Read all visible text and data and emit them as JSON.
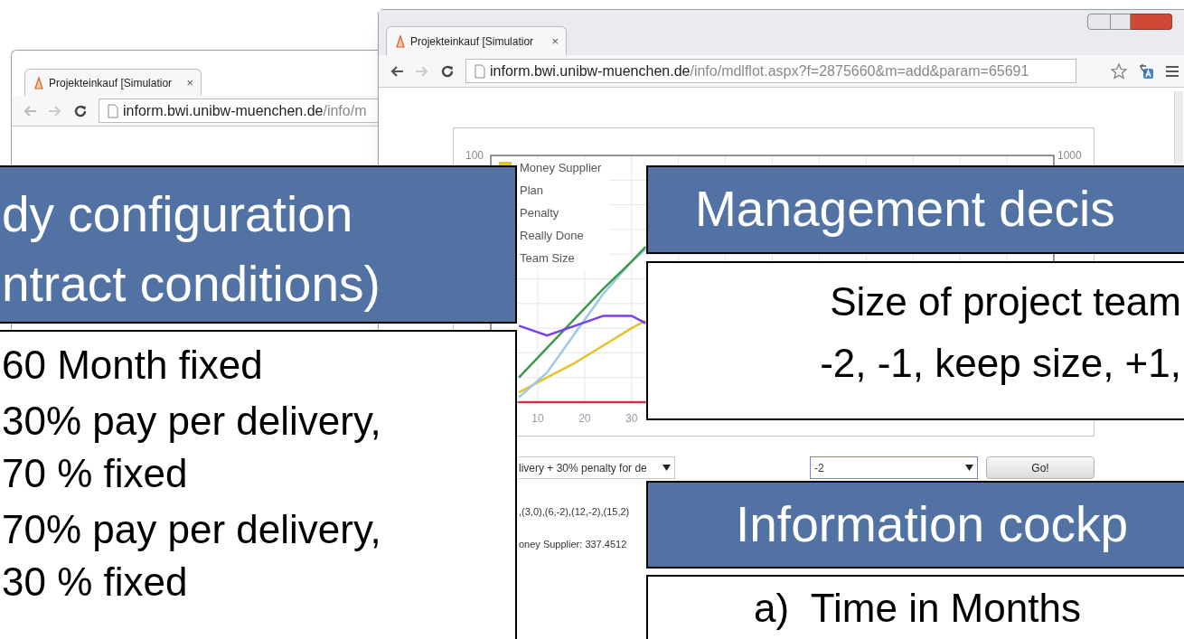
{
  "back_window": {
    "tab_title": "Projekteinkauf [Simulatior",
    "tab_close": "×",
    "url_host": "inform.bwi.unibw-muenchen.de",
    "url_path": "/info/m"
  },
  "front_window": {
    "tab_title": "Projekteinkauf [Simulatior",
    "tab_close": "×",
    "url_host": "inform.bwi.unibw-muenchen.de",
    "url_path": "/info/mdlflot.aspx?f=2875660&m=add&param=65691",
    "chart": {
      "legend": [
        "Money Supplier",
        "Plan",
        "Penalty",
        "Really Done",
        "Team Size"
      ],
      "left_axis_label": "100",
      "right_axis_label": "1000",
      "x_axis_labels": [
        "10",
        "20",
        "30"
      ]
    },
    "plan_select": {
      "value": "livery + 30% penalty for de"
    },
    "team_select": {
      "value": "-2"
    },
    "go_button": "Go!",
    "output_lines": [
      ",(3,0),(6,-2),(12,-2),(15,2)",
      "oney Supplier: 337.4512"
    ]
  },
  "callouts": [
    {
      "kind": "title",
      "lines": [
        "dy configuration",
        "ntract conditions)"
      ]
    },
    {
      "kind": "list",
      "items": [
        "60 Month fixed",
        "30% pay per delivery,\n70 % fixed",
        "70% pay per delivery,\n30 % fixed"
      ]
    },
    {
      "kind": "title",
      "lines": [
        "Management decis"
      ]
    },
    {
      "kind": "list",
      "items": [
        "Size of project team",
        "-2, -1, keep size, +1,"
      ]
    },
    {
      "kind": "title",
      "lines": [
        "Information cockp"
      ]
    },
    {
      "kind": "list",
      "items": [
        "a)  Time in Months"
      ]
    }
  ]
}
